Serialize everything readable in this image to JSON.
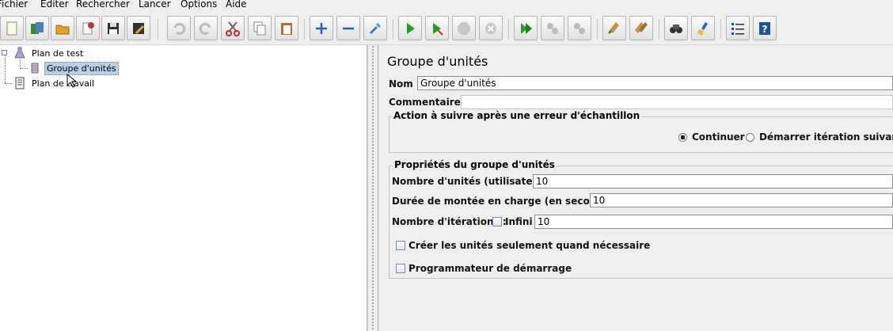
{
  "menu": [
    "Fichier",
    "Editer",
    "Rechercher",
    "Lancer",
    "Options",
    "Aide"
  ],
  "toolbar": {
    "buttons": [
      "new-icon",
      "templates-icon",
      "open-icon",
      "close-icon",
      "save-icon",
      "save-as-icon",
      "undo-icon",
      "redo-icon",
      "cut-icon",
      "copy-icon",
      "paste-icon",
      "expand-icon",
      "collapse-icon",
      "toggle-icon",
      "start-icon",
      "start-no-pause-icon",
      "stop-icon",
      "shutdown-icon",
      "remote-start-icon",
      "remote-stop-icon",
      "remote-shutdown-icon",
      "clear-icon",
      "clear-all-icon",
      "search-icon",
      "reset-search-icon",
      "function-helper-icon",
      "help-icon"
    ]
  },
  "tree": {
    "root": "Plan de test",
    "child": "Groupe d'unités",
    "workbench": "Plan de travail"
  },
  "panel": {
    "title": "Groupe d'unités",
    "name_label": "Nom :",
    "name_value": "Groupe d'unités",
    "comments_label": "Commentaires :",
    "error_group_title": "Action à suivre après une erreur d'échantillon",
    "radio_continue": "Continuer",
    "radio_next_iteration": "Démarrer itération suivante",
    "props_group_title": "Propriétés du groupe d'unités",
    "threads_label": "Nombre d'unités (utilisateurs) :",
    "threads_value": "10",
    "rampup_label": "Durée de montée en charge (en secondes) :",
    "rampup_value": "10",
    "iterations_label": "Nombre d'itérations :",
    "infinite_label": "Infini",
    "iterations_value": "10",
    "delay_create_label": "Créer les unités seulement quand nécessaire",
    "scheduler_label": "Programmateur de démarrage"
  }
}
